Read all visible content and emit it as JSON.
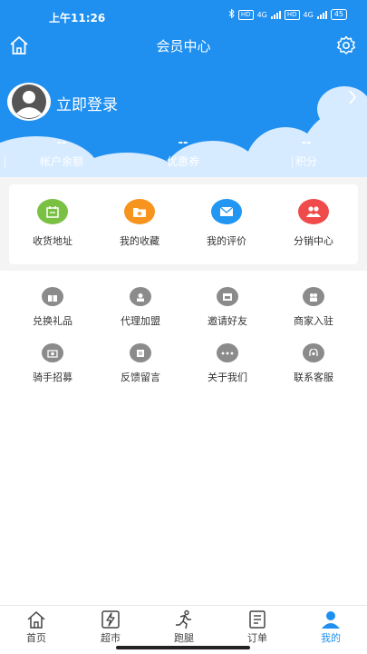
{
  "status_bar": {
    "time": "上午11:26",
    "hd1": "HD",
    "hd2": "HD",
    "net1": "4G",
    "net2": "4G",
    "battery": "45"
  },
  "header": {
    "title": "会员中心"
  },
  "profile": {
    "login_label": "立即登录"
  },
  "stats": [
    {
      "value": "--",
      "label": "帐户余额"
    },
    {
      "value": "--",
      "label": "优惠券"
    },
    {
      "value": "--",
      "label": "积分"
    }
  ],
  "quick_actions": [
    {
      "label": "收货地址",
      "icon": "calendar-icon",
      "color": "#7ac143"
    },
    {
      "label": "我的收藏",
      "icon": "star-folder-icon",
      "color": "#f7941d"
    },
    {
      "label": "我的评价",
      "icon": "mail-icon",
      "color": "#2196f3"
    },
    {
      "label": "分销中心",
      "icon": "users-icon",
      "color": "#f04b4b"
    }
  ],
  "services": [
    {
      "label": "兑换礼品",
      "icon": "gift-icon"
    },
    {
      "label": "代理加盟",
      "icon": "agent-icon"
    },
    {
      "label": "邀请好友",
      "icon": "invite-icon"
    },
    {
      "label": "商家入驻",
      "icon": "merchant-icon"
    },
    {
      "label": "骑手招募",
      "icon": "camera-icon"
    },
    {
      "label": "反馈留言",
      "icon": "feedback-icon"
    },
    {
      "label": "关于我们",
      "icon": "more-icon"
    },
    {
      "label": "联系客服",
      "icon": "service-icon"
    }
  ],
  "tabbar": [
    {
      "label": "首页",
      "icon": "home-icon"
    },
    {
      "label": "超市",
      "icon": "lightning-icon"
    },
    {
      "label": "跑腿",
      "icon": "runner-icon"
    },
    {
      "label": "订单",
      "icon": "order-icon"
    },
    {
      "label": "我的",
      "icon": "person-icon",
      "active": true
    }
  ],
  "colors": {
    "primary": "#1f8ff0",
    "cloud": "#d6ebff"
  }
}
